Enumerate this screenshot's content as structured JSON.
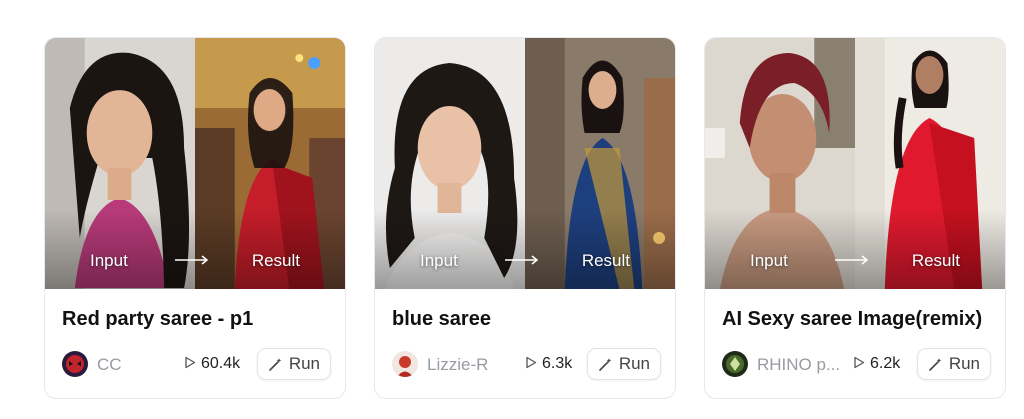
{
  "labels": {
    "input": "Input",
    "result": "Result",
    "run": "Run"
  },
  "cards": [
    {
      "title": "Red party saree - p1",
      "author": "CC",
      "runs": "60.4k"
    },
    {
      "title": "blue saree",
      "author": "Lizzie-R",
      "runs": "6.3k"
    },
    {
      "title": "AI Sexy saree Image(remix)",
      "author": "RHINO p...",
      "runs": "6.2k"
    }
  ],
  "icons": {
    "play": "play-icon",
    "run": "magic-wand-icon",
    "arrow": "arrow-right-icon"
  }
}
